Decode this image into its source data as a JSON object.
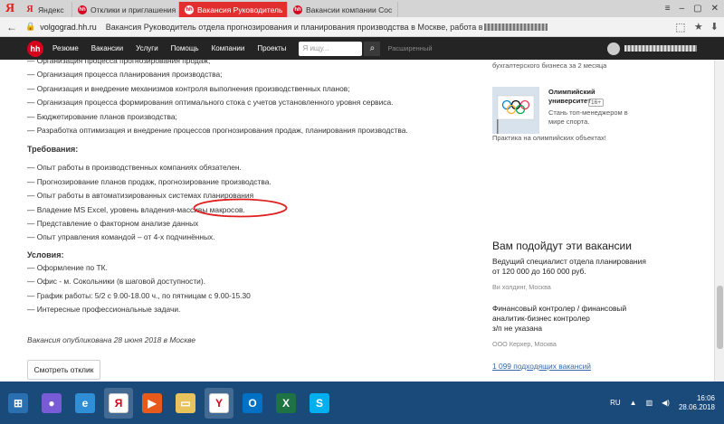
{
  "browser": {
    "brand": "Я",
    "tabs": [
      {
        "label": "Яндекс",
        "icon": "yandex-icon",
        "active": false
      },
      {
        "label": "Отклики и приглашения",
        "icon": "hh-icon",
        "active": false
      },
      {
        "label": "Вакансия Руководитель",
        "icon": "hh-icon",
        "active": true
      },
      {
        "label": "Вакансии компании Coc",
        "icon": "hh-icon",
        "active": false
      }
    ],
    "close_glyph": "✕",
    "address_host": "volgograd.hh.ru",
    "address_title": "Вакансия Руководитель отдела прогнозирования и планирования производства в Москве, работа в"
  },
  "hh_nav": {
    "logo": "hh",
    "items": [
      "Резюме",
      "Вакансии",
      "Услуги",
      "Помощь",
      "Компании",
      "Проекты"
    ],
    "search_placeholder": "Я ищу...",
    "advanced": "Расширенный"
  },
  "main": {
    "duties": [
      "Организация процесса прогнозирования продаж;",
      "Организация процесса планирования производства;",
      "Организация и внедрение механизмов контроля выполнения производственных планов;",
      "Организация процесса формирования оптимального стока с учетов установленного уровня сервиса.",
      "Бюджетирование планов производства;",
      "Разработка оптимизация и внедрение процессов прогнозирования продаж, планирования производства."
    ],
    "requirements_title": "Требования:",
    "requirements": [
      "Опыт работы в производственных компаниях обязателен.",
      " Прогнозирование планов продаж, прогнозирование производства.",
      "Опыт работы в автоматизированных системах планирования",
      "Владение MS Excel, уровень владения-массивы макросов.",
      "Представление о факторном анализе данных",
      "Опыт управления командой – от 4-х подчинённых."
    ],
    "conditions_title": "Условия:",
    "conditions": [
      "Оформление по ТК.",
      "Офис - м. Сокольники (в шаговой доступности).",
      "График работы: 5/2 с 9.00-18.00 ч., по пятницам с 9.00-15.30",
      "Интересные профессиональные задачи."
    ],
    "published": "Вакансия опубликована 28 июня 2018 в Москве",
    "response_button": "Смотреть отклик"
  },
  "sidebar": {
    "top_fragment": "бухгалтерского бизнеса за 2 месяца",
    "promo_title": "Олимпийский университет",
    "promo_badge": "16+",
    "promo_text": "Стань топ-менеджером в мире спорта.",
    "promo_footer": "Практика на олимпийских объектах!",
    "rec_title": "Вам подойдут эти вакансии",
    "vacancies": [
      {
        "title": "Ведущий специалист отдела планирования",
        "salary": "от 120 000 до 160 000 руб.",
        "company": "Ви холдинг, Москва"
      },
      {
        "title": "Финансовый контролер / финансовый аналитик-бизнес контролер",
        "salary": "з/п не указана",
        "company": "ООО Керхер, Москва"
      }
    ],
    "more_link": "1 099 подходящих вакансий"
  },
  "taskbar": {
    "lang": "RU",
    "time": "16:06",
    "date": "28.06.2018",
    "apps": [
      {
        "name": "windows-start-icon",
        "color": "#2a6fb0",
        "glyph": "⊞"
      },
      {
        "name": "microphone-icon",
        "color": "#7a5bd6",
        "glyph": "●"
      },
      {
        "name": "internet-explorer-icon",
        "color": "#2f8ed6",
        "glyph": "e"
      },
      {
        "name": "yandex-browser-icon",
        "color": "#ffffff",
        "glyph": "Я"
      },
      {
        "name": "video-icon",
        "color": "#e85a1b",
        "glyph": "▶"
      },
      {
        "name": "folder-icon",
        "color": "#e8c25a",
        "glyph": "▭"
      },
      {
        "name": "yandex-icon",
        "color": "#ffffff",
        "glyph": "Y"
      },
      {
        "name": "outlook-icon",
        "color": "#0072c6",
        "glyph": "O"
      },
      {
        "name": "excel-icon",
        "color": "#1f7244",
        "glyph": "X"
      },
      {
        "name": "skype-icon",
        "color": "#00aff0",
        "glyph": "S"
      }
    ]
  }
}
